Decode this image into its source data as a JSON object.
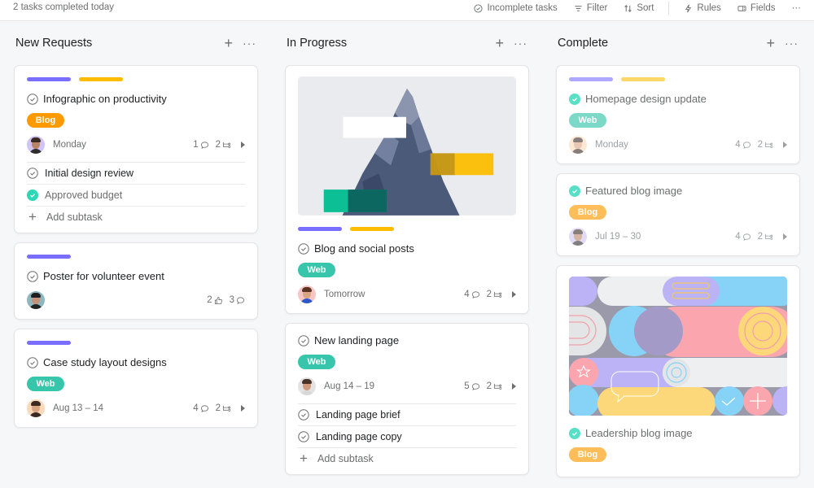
{
  "header": {
    "status_text": "2 tasks completed today",
    "toolbar": [
      {
        "label": "Incomplete tasks",
        "icon": "check-circle-icon"
      },
      {
        "label": "Filter",
        "icon": "filter-icon"
      },
      {
        "label": "Sort",
        "icon": "sort-icon"
      },
      {
        "label": "Rules",
        "icon": "lightning-icon"
      },
      {
        "label": "Fields",
        "icon": "fields-icon"
      }
    ],
    "more_label": "···"
  },
  "colors": {
    "purple": "#796eff",
    "yellow": "#fcbd01",
    "teal": "#37c5ab",
    "orange": "#fd9a00",
    "check_done": "#58e0c7",
    "light_purple": "#b6adf8",
    "light_yellow": "#fdd98a"
  },
  "columns": [
    {
      "title": "New Requests",
      "add_label": "+",
      "more_label": "···",
      "cards": [
        {
          "title": "Infographic on productivity",
          "tag": "Blog",
          "due": "Monday",
          "comments": "1",
          "subtask_count": "2",
          "subtasks": [
            {
              "label": "Initial design review",
              "done": false
            },
            {
              "label": "Approved budget",
              "done": true
            }
          ],
          "add_subtask_label": "Add subtask"
        },
        {
          "title": "Poster for volunteer event",
          "likes": "2",
          "comments": "3"
        },
        {
          "title": "Case study layout designs",
          "tag": "Web",
          "due": "Aug 13 – 14",
          "comments": "4",
          "subtask_count": "2"
        }
      ]
    },
    {
      "title": "In Progress",
      "add_label": "+",
      "more_label": "···",
      "cards": [
        {
          "title": "Blog and social posts",
          "tag": "Web",
          "due": "Tomorrow",
          "comments": "4",
          "subtask_count": "2",
          "cover": "mountain-image"
        },
        {
          "title": "New landing page",
          "tag": "Web",
          "due": "Aug 14 – 19",
          "comments": "5",
          "subtask_count": "2",
          "subtasks": [
            {
              "label": "Landing page brief",
              "done": false
            },
            {
              "label": "Landing page copy",
              "done": false
            }
          ],
          "add_subtask_label": "Add subtask"
        }
      ]
    },
    {
      "title": "Complete",
      "add_label": "+",
      "more_label": "···",
      "cards": [
        {
          "title": "Homepage design update",
          "tag": "Web",
          "due": "Monday",
          "comments": "4",
          "subtask_count": "2",
          "completed": true
        },
        {
          "title": "Featured blog image",
          "tag": "Blog",
          "due": "Jul 19 – 30",
          "comments": "4",
          "subtask_count": "2",
          "completed": true
        },
        {
          "title": "Leadership blog image",
          "tag": "Blog",
          "completed": true,
          "cover": "geometric-pattern-image"
        }
      ]
    }
  ]
}
